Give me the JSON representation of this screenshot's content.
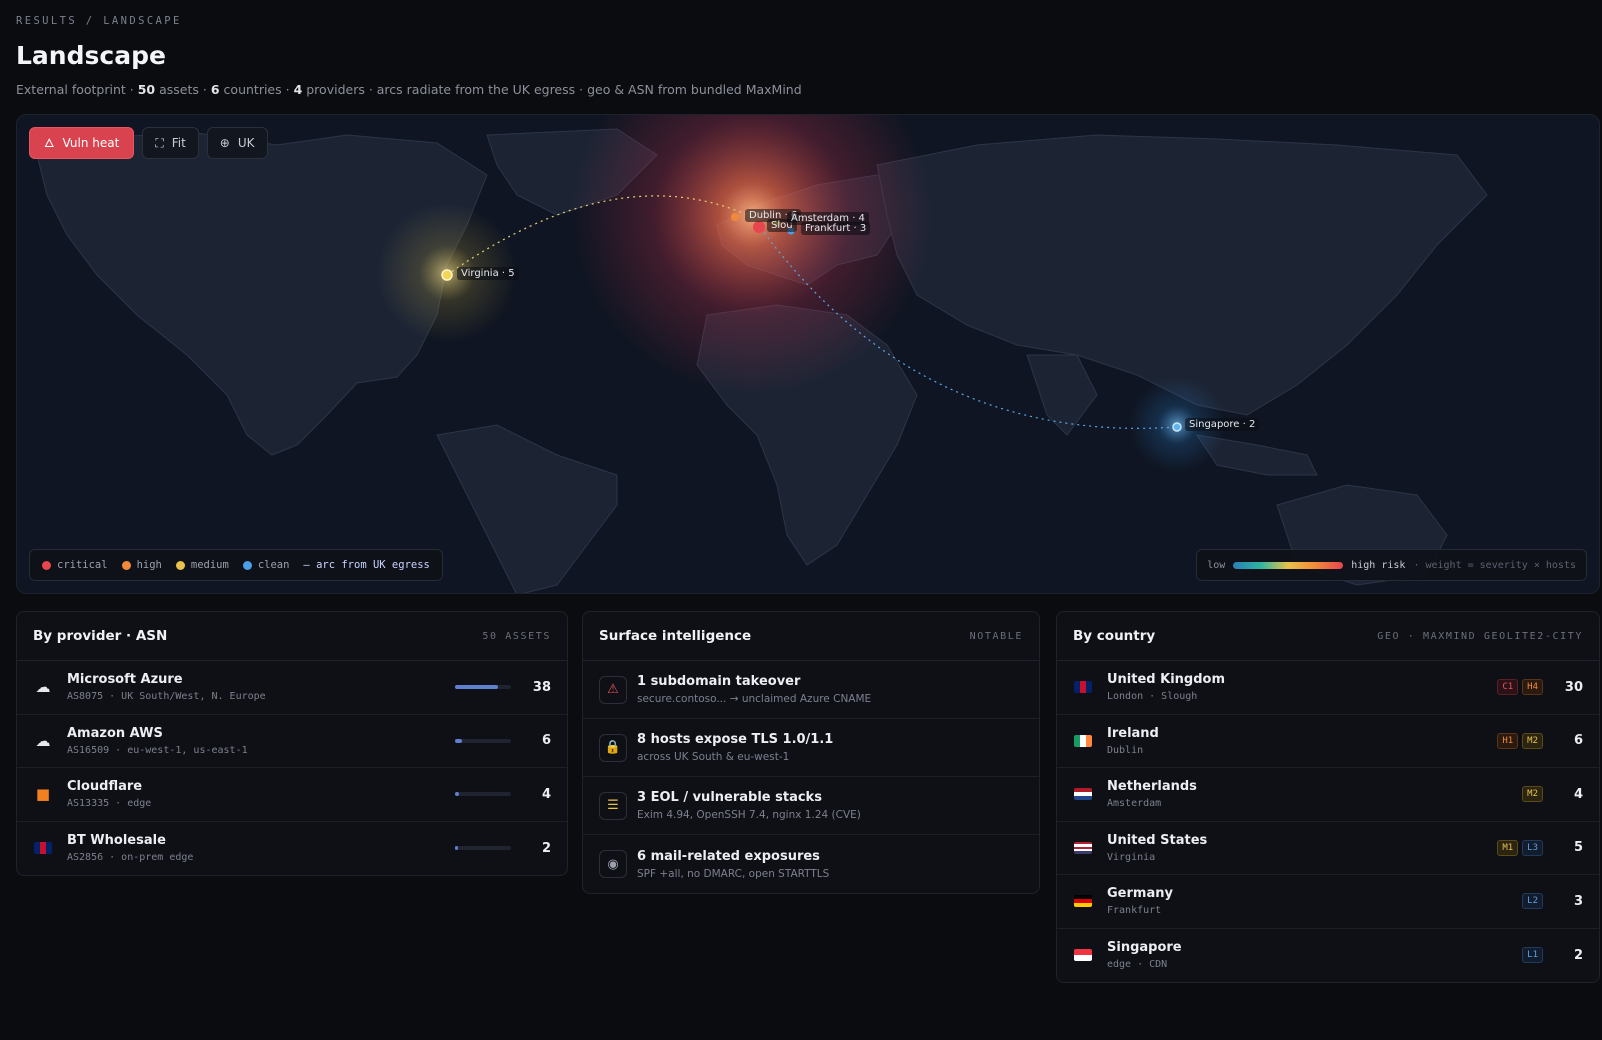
{
  "breadcrumb": "RESULTS / LANDSCAPE",
  "page_title": "Landscape",
  "subtitle": {
    "lead": "External footprint ·",
    "assets_count": "50",
    "assets_word": "assets ·",
    "countries_count": "6",
    "countries_word": "countries ·",
    "providers_count": "4",
    "providers_word": "providers · arcs radiate from the UK egress · geo & ASN from bundled MaxMind"
  },
  "map": {
    "toolbar": {
      "vuln_heat": "Vuln heat",
      "fit": "Fit",
      "uk": "UK"
    },
    "markers": {
      "dublin": "Dublin · 6",
      "amsterdam": "Amsterdam · 4",
      "frankfurt": "Frankfurt · 3",
      "virginia": "Virginia · 5",
      "singapore": "Singapore · 2",
      "london_partial": "Slou"
    },
    "legend": {
      "critical": "critical",
      "high": "high",
      "medium": "medium",
      "clean": "clean",
      "arc": "— arc from UK egress"
    },
    "risk_scale": {
      "low": "low",
      "high": "high risk",
      "note": "· weight = severity × hosts"
    },
    "colors": {
      "critical": "#e8464f",
      "high": "#f08a3a",
      "medium": "#e8c24a",
      "clean": "#4a9fe8"
    }
  },
  "providers": {
    "title": "By provider · ASN",
    "meta": "50 ASSETS",
    "items": [
      {
        "icon": "cloud-icon",
        "name": "Microsoft Azure",
        "sub": "AS8075 · UK South/West, N. Europe",
        "count": "38",
        "share": 0.76
      },
      {
        "icon": "cloud-icon",
        "name": "Amazon AWS",
        "sub": "AS16509 · eu-west-1, us-east-1",
        "count": "6",
        "share": 0.12
      },
      {
        "icon": "square-icon",
        "name": "Cloudflare",
        "sub": "AS13335 · edge",
        "count": "4",
        "share": 0.08
      },
      {
        "icon": "uk-flag-icon",
        "name": "BT Wholesale",
        "sub": "AS2856 · on-prem edge",
        "count": "2",
        "share": 0.04
      }
    ]
  },
  "intel": {
    "title": "Surface intelligence",
    "meta": "NOTABLE",
    "items": [
      {
        "icon": "warning-icon",
        "title": "1 subdomain takeover",
        "sub": "secure.contoso...  → unclaimed Azure CNAME",
        "color": "#e8525c"
      },
      {
        "icon": "lock-icon",
        "title": "8 hosts expose TLS 1.0/1.1",
        "sub": "across UK South & eu-west-1",
        "color": "#f08a3a"
      },
      {
        "icon": "list-icon",
        "title": "3 EOL / vulnerable stacks",
        "sub": "Exim 4.94, OpenSSH 7.4, nginx 1.24 (CVE)",
        "color": "#e8c24a"
      },
      {
        "icon": "eye-icon",
        "title": "6 mail-related exposures",
        "sub": "SPF +all, no DMARC, open STARTTLS",
        "color": "#9ca0ad"
      }
    ]
  },
  "countries": {
    "title": "By country",
    "meta": "GEO · MAXMIND GEOLITE2-CITY",
    "items": [
      {
        "flag": "uk",
        "name": "United Kingdom",
        "sub": "London · Slough",
        "badges": [
          [
            "C1",
            "c"
          ],
          [
            "H4",
            "h"
          ]
        ],
        "count": "30"
      },
      {
        "flag": "ie",
        "name": "Ireland",
        "sub": "Dublin",
        "badges": [
          [
            "H1",
            "h"
          ],
          [
            "M2",
            "m"
          ]
        ],
        "count": "6"
      },
      {
        "flag": "nl",
        "name": "Netherlands",
        "sub": "Amsterdam",
        "badges": [
          [
            "M2",
            "m"
          ]
        ],
        "count": "4"
      },
      {
        "flag": "us",
        "name": "United States",
        "sub": "Virginia",
        "badges": [
          [
            "M1",
            "m"
          ],
          [
            "L3",
            "l"
          ]
        ],
        "count": "5"
      },
      {
        "flag": "de",
        "name": "Germany",
        "sub": "Frankfurt",
        "badges": [
          [
            "L2",
            "l"
          ]
        ],
        "count": "3"
      },
      {
        "flag": "sg",
        "name": "Singapore",
        "sub": "edge · CDN",
        "badges": [
          [
            "L1",
            "l"
          ]
        ],
        "count": "2"
      }
    ]
  }
}
